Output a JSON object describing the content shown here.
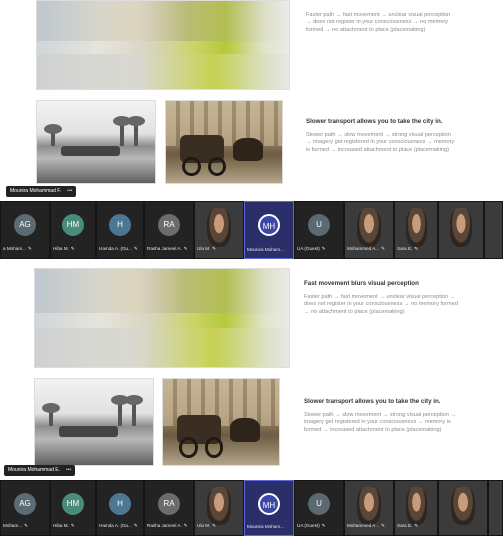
{
  "top": {
    "slide": {
      "intro_text": "Faster path → fast movement → unclear visual perception → does not register in your consciousness → no memory formed → no attachment to place (placemaking)",
      "heading2": "Slower transport allows you to take the city in.",
      "text2": "Slower path → slow movement → strong visual perception → imagery get registered in your consciousness → memory is formed → increased attachment to place (placemaking)"
    },
    "presenter_tag": "Mounira Mohammad F.",
    "dots": "•••",
    "participants": [
      {
        "initials": "AG",
        "name": "a Moham...",
        "color": "#5c6b73"
      },
      {
        "initials": "HM",
        "name": "Hiba M.",
        "color": "#4a8c7a"
      },
      {
        "initials": "H",
        "name": "Hamda A. (Gu...",
        "color": "#4b7694"
      },
      {
        "initials": "RA",
        "name": "Rasha Jameel A.",
        "color": "#6c6c6c"
      },
      {
        "initials": "",
        "name": "Ula M.",
        "color": ""
      },
      {
        "initials": "MH",
        "name": "Mounira Moham...",
        "color": "#3d47a8"
      },
      {
        "initials": "U",
        "name": "UA (Guest)",
        "color": "#5b6a72"
      },
      {
        "initials": "",
        "name": "Mohammed A...",
        "color": ""
      },
      {
        "initials": "",
        "name": "Sara E.",
        "color": ""
      },
      {
        "initials": "",
        "name": "",
        "color": ""
      }
    ]
  },
  "bottom": {
    "slide": {
      "heading1": "Fast movement blurs visual perception",
      "intro_text": "Faster path → fast movement → unclear visual perception → does not register in your consciousness → no memory formed → no attachment to place (placemaking)",
      "heading2": "Slower transport allows you to take the city in.",
      "text2": "Slower path → slow movement → strong visual perception → imagery get registered in your consciousness → memory is formed → increased attachment to place (placemaking)"
    },
    "presenter_tag": "Mounira Mohammad E.",
    "dots": "•••",
    "participants": [
      {
        "initials": "AG",
        "name": "Moham...",
        "color": "#5c6b73"
      },
      {
        "initials": "HM",
        "name": "Hiba M.",
        "color": "#4a8c7a"
      },
      {
        "initials": "H",
        "name": "Hamda A. (Gu...",
        "color": "#4b7694"
      },
      {
        "initials": "RA",
        "name": "Rasha Jameel A.",
        "color": "#6c6c6c"
      },
      {
        "initials": "",
        "name": "Ula M.",
        "color": ""
      },
      {
        "initials": "MH",
        "name": "Mounira Moham...",
        "color": "#3d47a8"
      },
      {
        "initials": "U",
        "name": "UA (Guest)",
        "color": "#5b6a72"
      },
      {
        "initials": "",
        "name": "Mohammed A...",
        "color": ""
      },
      {
        "initials": "",
        "name": "Sara E.",
        "color": ""
      },
      {
        "initials": "",
        "name": "",
        "color": ""
      }
    ]
  },
  "mic_glyph": "✎"
}
